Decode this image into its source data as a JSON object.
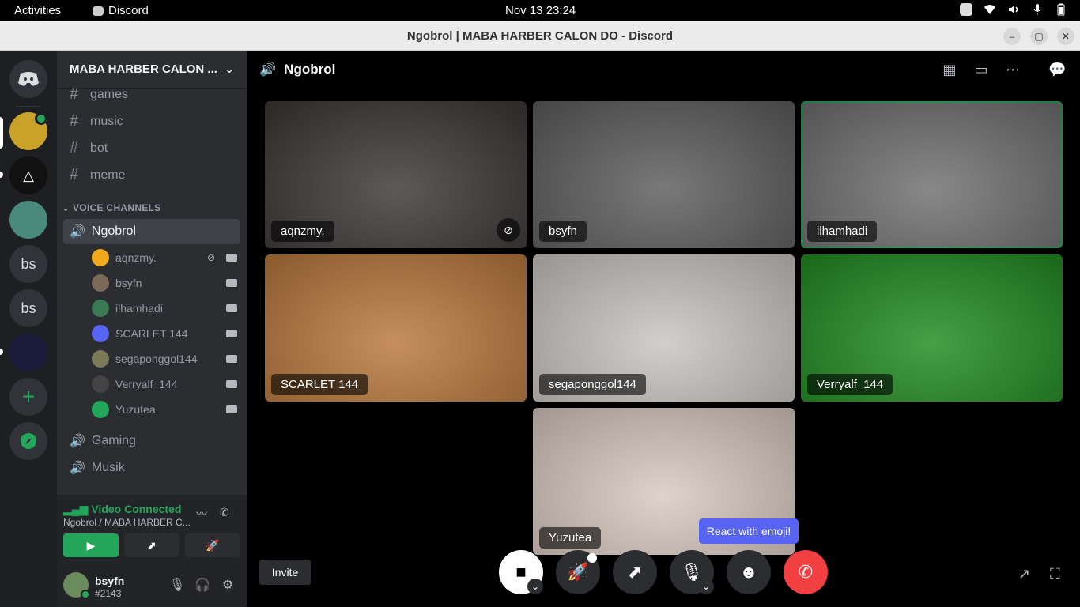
{
  "topbar": {
    "activities": "Activities",
    "app_name": "Discord",
    "clock": "Nov 13  23:24"
  },
  "window": {
    "title": "Ngobrol | MABA HARBER CALON DO - Discord"
  },
  "rail": {
    "servers": [
      "bs",
      "bs"
    ]
  },
  "guild": {
    "name": "MABA HARBER CALON ..."
  },
  "text_channels": [
    "games",
    "music",
    "bot",
    "meme"
  ],
  "voice_category": "VOICE CHANNELS",
  "voice_channels": {
    "active": "Ngobrol",
    "others": [
      "Gaming",
      "Musik"
    ]
  },
  "voice_users": [
    {
      "name": "aqnzmy.",
      "muted": true,
      "avatar_color": "#f0a91d"
    },
    {
      "name": "bsyfn",
      "muted": false,
      "avatar_color": "#7b6a5a"
    },
    {
      "name": "ilhamhadi",
      "muted": false,
      "avatar_color": "#3a7a52"
    },
    {
      "name": "SCARLET 144",
      "muted": false,
      "avatar_color": "#5865f2"
    },
    {
      "name": "segaponggol144",
      "muted": false,
      "avatar_color": "#7d7a5a"
    },
    {
      "name": "Verryalf_144",
      "muted": false,
      "avatar_color": "#444"
    },
    {
      "name": "Yuzutea",
      "muted": false,
      "avatar_color": "#23a55a"
    }
  ],
  "voice_panel": {
    "status": "Video Connected",
    "location": "Ngobrol / MABA HARBER C..."
  },
  "user": {
    "name": "bsyfn",
    "tag": "#2143"
  },
  "call": {
    "channel": "Ngobrol",
    "tiles": [
      {
        "name": "aqnzmy.",
        "muted": true,
        "bg": "#3a3535"
      },
      {
        "name": "bsyfn",
        "muted": false,
        "bg": "#5a5c5a"
      },
      {
        "name": "ilhamhadi",
        "muted": false,
        "bg": "#6e6e70",
        "speaking": true
      },
      {
        "name": "SCARLET 144",
        "muted": false,
        "bg": "#b8773a"
      },
      {
        "name": "segaponggol144",
        "muted": false,
        "bg": "#c8c4c0"
      },
      {
        "name": "Verryalf_144",
        "muted": false,
        "bg": "#1f8a1f"
      },
      {
        "name": "Yuzutea",
        "muted": false,
        "bg": "#d8c8c0"
      }
    ],
    "invite": "Invite",
    "tooltip": "React with emoji!"
  },
  "colors": {
    "discord_green": "#23a55a",
    "blurple": "#5865f2",
    "hangup_red": "#f23f42"
  }
}
